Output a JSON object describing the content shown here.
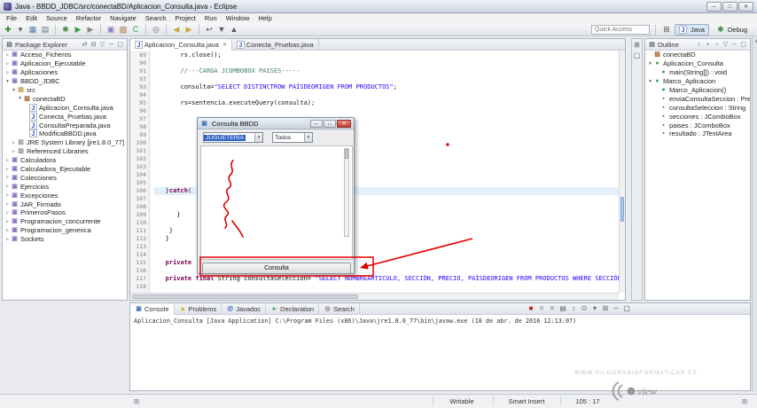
{
  "window": {
    "title": "Java - BBDD_JDBC/src/conectaBD/Aplicacion_Consulta.java - Eclipse",
    "minimize": "─",
    "maximize": "□",
    "close": "✕"
  },
  "menubar": {
    "items": [
      "File",
      "Edit",
      "Source",
      "Refactor",
      "Navigate",
      "Search",
      "Project",
      "Run",
      "Window",
      "Help"
    ]
  },
  "toolbar": {
    "quick_access": "Quick Access",
    "perspective_java": "Java",
    "perspective_debug": "Debug",
    "open_perspective_glyph": "⊞",
    "icons": [
      {
        "n": "new-wizard-icon",
        "g": "✚",
        "c": "#2d8a2d"
      },
      {
        "n": "new-dropdown-icon",
        "g": "▾",
        "c": "#555"
      },
      {
        "n": "save-icon",
        "g": "▦",
        "c": "#5577aa"
      },
      {
        "n": "print-icon",
        "g": "▤",
        "c": "#667788"
      },
      {
        "sep": true
      },
      {
        "n": "debug-icon",
        "g": "✱",
        "c": "#3c8c3c"
      },
      {
        "n": "run-icon",
        "g": "▶",
        "c": "#2f9e44"
      },
      {
        "n": "external-tools-icon",
        "g": "▶",
        "c": "#888888"
      },
      {
        "sep": true
      },
      {
        "n": "new-java-project-icon",
        "g": "▣",
        "c": "#8a74c4"
      },
      {
        "n": "new-package-icon",
        "g": "▨",
        "c": "#a0642d"
      },
      {
        "n": "new-class-icon",
        "g": "C",
        "c": "#2f9e44"
      },
      {
        "sep": true
      },
      {
        "n": "search-icon",
        "g": "◎",
        "c": "#666666"
      },
      {
        "sep": true
      },
      {
        "n": "back-icon",
        "g": "◀",
        "c": "#caa53d"
      },
      {
        "n": "forward-icon",
        "g": "▶",
        "c": "#caa53d"
      },
      {
        "sep": true
      },
      {
        "n": "last-edit-location-icon",
        "g": "↩",
        "c": "#556"
      },
      {
        "n": "next-annotation-icon",
        "g": "▼",
        "c": "#556"
      },
      {
        "n": "previous-annotation-icon",
        "g": "▲",
        "c": "#556"
      }
    ]
  },
  "package_explorer": {
    "title": "Package Explorer",
    "header_icons": [
      {
        "n": "link-with-editor-icon",
        "g": "⇄"
      },
      {
        "n": "collapse-all-icon",
        "g": "⊟"
      },
      {
        "n": "view-menu-icon",
        "g": "▽"
      },
      {
        "n": "minimize-view-icon",
        "g": "─"
      },
      {
        "n": "maximize-view-icon",
        "g": "▢"
      }
    ],
    "items": [
      {
        "label": "Acceso_Ficheros",
        "indent": 0,
        "icon": "project-icon",
        "arrow": "closed"
      },
      {
        "label": "Aplicacion_Ejecutable",
        "indent": 0,
        "icon": "project-icon",
        "arrow": "closed"
      },
      {
        "label": "Aplicaciones",
        "indent": 0,
        "icon": "project-icon",
        "arrow": "closed"
      },
      {
        "label": "BBDD_JDBC",
        "indent": 0,
        "icon": "project-icon",
        "arrow": "open"
      },
      {
        "label": "src",
        "indent": 1,
        "icon": "src-folder-icon",
        "arrow": "open"
      },
      {
        "label": "conectaBD",
        "indent": 2,
        "icon": "package-icon",
        "arrow": "open"
      },
      {
        "label": "Aplicacion_Consulta.java",
        "indent": 3,
        "icon": "java-file-icon"
      },
      {
        "label": "Conecta_Pruebas.java",
        "indent": 3,
        "icon": "java-file-icon"
      },
      {
        "label": "ConsultaPreparada.java",
        "indent": 3,
        "icon": "java-file-icon"
      },
      {
        "label": "ModificaBBDD.java",
        "indent": 3,
        "icon": "java-file-icon"
      },
      {
        "label": "JRE System Library [jre1.8.0_77]",
        "indent": 1,
        "icon": "library-icon",
        "arrow": "closed"
      },
      {
        "label": "Referenced Libraries",
        "indent": 1,
        "icon": "library-icon",
        "arrow": "closed"
      },
      {
        "label": "Calculadora",
        "indent": 0,
        "icon": "project-icon",
        "arrow": "closed"
      },
      {
        "label": "Calculadora_Ejecutable",
        "indent": 0,
        "icon": "project-icon",
        "arrow": "closed"
      },
      {
        "label": "Colecciones",
        "indent": 0,
        "icon": "project-icon",
        "arrow": "closed"
      },
      {
        "label": "Ejercicios",
        "indent": 0,
        "icon": "project-icon",
        "arrow": "closed"
      },
      {
        "label": "Excepciones",
        "indent": 0,
        "icon": "project-icon",
        "arrow": "closed"
      },
      {
        "label": "JAR_Firmado",
        "indent": 0,
        "icon": "project-icon",
        "arrow": "closed"
      },
      {
        "label": "PrimerosPasos",
        "indent": 0,
        "icon": "project-icon",
        "arrow": "closed"
      },
      {
        "label": "Programacion_concurrente",
        "indent": 0,
        "icon": "project-icon",
        "arrow": "closed"
      },
      {
        "label": "Programacion_generica",
        "indent": 0,
        "icon": "project-icon",
        "arrow": "closed"
      },
      {
        "label": "Sockets",
        "indent": 0,
        "icon": "project-icon",
        "arrow": "closed"
      }
    ]
  },
  "editor": {
    "tabs": [
      {
        "label": "Aplicacion_Consulta.java",
        "active": true
      },
      {
        "label": "Conecta_Pruebas.java",
        "active": false
      }
    ],
    "lines": [
      {
        "n": 89,
        "seg": [
          [
            "pl",
            "       rs.close();"
          ]
        ]
      },
      {
        "n": 90,
        "seg": []
      },
      {
        "n": 91,
        "seg": [
          [
            "com",
            "       //---CARGA JCOMBOBOX PAISES-----"
          ]
        ]
      },
      {
        "n": 92,
        "seg": []
      },
      {
        "n": 93,
        "seg": [
          [
            "pl",
            "       consulta="
          ],
          [
            "str",
            "\"SELECT DISTINCTROW PAÍSDEORIGEN FROM PRODUCTOS\""
          ],
          [
            "pl",
            ";"
          ]
        ]
      },
      {
        "n": 94,
        "seg": []
      },
      {
        "n": 95,
        "seg": [
          [
            "pl",
            "       rs=sentencia.executeQuery(consulta);"
          ]
        ]
      },
      {
        "n": 96,
        "seg": []
      },
      {
        "n": 97,
        "seg": []
      },
      {
        "n": 98,
        "seg": []
      },
      {
        "n": 99,
        "seg": []
      },
      {
        "n": 100,
        "seg": []
      },
      {
        "n": 101,
        "seg": []
      },
      {
        "n": 102,
        "seg": []
      },
      {
        "n": 103,
        "seg": []
      },
      {
        "n": 104,
        "seg": []
      },
      {
        "n": 105,
        "seg": []
      },
      {
        "n": 106,
        "hl": true,
        "seg": [
          [
            "pl",
            "   }"
          ],
          [
            "kw",
            "catch"
          ],
          [
            "pl",
            "("
          ]
        ]
      },
      {
        "n": 107,
        "seg": []
      },
      {
        "n": 108,
        "seg": []
      },
      {
        "n": 109,
        "seg": [
          [
            "pl",
            "      }"
          ]
        ]
      },
      {
        "n": 110,
        "seg": []
      },
      {
        "n": 111,
        "seg": [
          [
            "pl",
            "    }"
          ]
        ]
      },
      {
        "n": 112,
        "seg": [
          [
            "pl",
            "   }"
          ]
        ]
      },
      {
        "n": 113,
        "seg": []
      },
      {
        "n": 114,
        "seg": []
      },
      {
        "n": 115,
        "seg": [
          [
            "kw",
            "   private"
          ]
        ]
      },
      {
        "n": 116,
        "seg": []
      },
      {
        "n": 117,
        "seg": [
          [
            "kw",
            "   private final"
          ],
          [
            "pl",
            " String consultaSeleccion= "
          ],
          [
            "str",
            "\"SELECT NOMBREARTICULO, SECCIÓN, PRECIO, PAÍSDEORIGEN FROM PRODUCTOS WHERE SECCIÓN=?\""
          ],
          [
            "pl",
            ";"
          ]
        ]
      },
      {
        "n": 118,
        "seg": []
      }
    ]
  },
  "dialog": {
    "title": "Consulta BBDD",
    "icon_glyph": "▣",
    "minimize": "─",
    "maximize": "□",
    "close": "✕",
    "combo_section_value": "JUGUETERÍA",
    "combo_filter_value": "Todos",
    "combo_arrow": "▾",
    "button_label": "Consulta"
  },
  "outline": {
    "title": "Outline",
    "header_icons": [
      {
        "n": "sort-icon",
        "g": "↕"
      },
      {
        "n": "hide-fields-icon",
        "g": "▪"
      },
      {
        "n": "hide-static-members-icon",
        "g": "▫"
      },
      {
        "n": "view-menu-icon",
        "g": "▽"
      },
      {
        "n": "minimize-view-icon",
        "g": "─"
      },
      {
        "n": "maximize-view-icon",
        "g": "▢"
      }
    ],
    "items": [
      {
        "label": "conectaBD",
        "indent": 0,
        "icon": "package-icon"
      },
      {
        "label": "Aplicacion_Consulta",
        "indent": 0,
        "icon": "class-icon",
        "arrow": "open"
      },
      {
        "label": "main(String[]) : void",
        "indent": 1,
        "icon": "method-icon"
      },
      {
        "label": "Marco_Aplicacion",
        "indent": 0,
        "icon": "class-icon",
        "arrow": "open"
      },
      {
        "label": "Marco_Aplicacion()",
        "indent": 1,
        "icon": "method-icon"
      },
      {
        "label": "enviaConsultaSeccion : Prepare...",
        "indent": 1,
        "icon": "field-icon"
      },
      {
        "label": "consultaSeleccion : String",
        "indent": 1,
        "icon": "field-icon"
      },
      {
        "label": "secciones : JComboBox",
        "indent": 1,
        "icon": "field-icon"
      },
      {
        "label": "paises : JComboBox",
        "indent": 1,
        "icon": "field-icon"
      },
      {
        "label": "resultado : JTextArea",
        "indent": 1,
        "icon": "field-icon"
      }
    ]
  },
  "console": {
    "tabs": [
      {
        "label": "Console",
        "icon": "console-icon",
        "active": true
      },
      {
        "label": "Problems",
        "icon": "problems-icon",
        "active": false
      },
      {
        "label": "Javadoc",
        "icon": "javadoc-icon",
        "active": false
      },
      {
        "label": "Declaration",
        "icon": "declaration-icon",
        "active": false
      },
      {
        "label": "Search",
        "icon": "search-view-icon",
        "active": false
      }
    ],
    "actions": [
      {
        "n": "terminate-icon",
        "g": "■",
        "c": "#cc2222"
      },
      {
        "n": "remove-launch-icon",
        "g": "✕",
        "c": "#888"
      },
      {
        "n": "remove-all-launches-icon",
        "g": "✕",
        "c": "#888"
      },
      {
        "n": "clear-console-icon",
        "g": "▤",
        "c": "#667"
      },
      {
        "n": "scroll-lock-icon",
        "g": "↕",
        "c": "#667"
      },
      {
        "n": "pin-console-icon",
        "g": "⊙",
        "c": "#667"
      },
      {
        "n": "display-console-icon",
        "g": "▾",
        "c": "#667"
      },
      {
        "n": "open-console-icon",
        "g": "⊞",
        "c": "#667"
      },
      {
        "n": "minimize-view-icon",
        "g": "─",
        "c": "#444"
      },
      {
        "n": "maximize-view-icon",
        "g": "▢",
        "c": "#444"
      }
    ],
    "text": "Aplicacion_Consulta [Java Application] C:\\Program Files (x86)\\Java\\jre1.8.0_77\\bin\\javaw.exe (18 de abr. de 2016 12:13:07)"
  },
  "statusbar": {
    "writable": "Writable",
    "insert_mode": "Smart Insert",
    "position": "105 : 17",
    "trim_icon": "⊞"
  },
  "strips": {
    "mid": [
      {
        "n": "restore-editor-icon",
        "g": "⊞"
      },
      {
        "n": "restore-view-icon",
        "g": "▢"
      }
    ],
    "right": [
      {
        "n": "fast-view-icon",
        "g": "⊞"
      }
    ]
  },
  "watermark": {
    "text": "WWW.PILDORASINFORMATICAS.ES",
    "logo_text": "view"
  },
  "iconmap": {
    "project-icon": {
      "g": "▣",
      "c": "#8a74c4"
    },
    "src-folder-icon": {
      "g": "▤",
      "c": "#c08f32"
    },
    "package-icon": {
      "g": "▨",
      "c": "#a0642d"
    },
    "java-file-icon": {
      "g": "J",
      "c": "#2956c4",
      "bg": "#ffffff",
      "bd": "#aab4c4"
    },
    "library-icon": {
      "g": "▥",
      "c": "#8a8f98"
    },
    "class-icon": {
      "g": "●",
      "c": "#3da153"
    },
    "method-icon": {
      "g": "●",
      "c": "#3da153"
    },
    "field-icon": {
      "g": "▪",
      "c": "#c03030"
    },
    "console-icon": {
      "g": "▣",
      "c": "#4f74b8"
    },
    "problems-icon": {
      "g": "▲",
      "c": "#e0a000"
    },
    "javadoc-icon": {
      "g": "@",
      "c": "#2956c4"
    },
    "declaration-icon": {
      "g": "▸",
      "c": "#3da153"
    },
    "search-view-icon": {
      "g": "◎",
      "c": "#777777"
    }
  }
}
